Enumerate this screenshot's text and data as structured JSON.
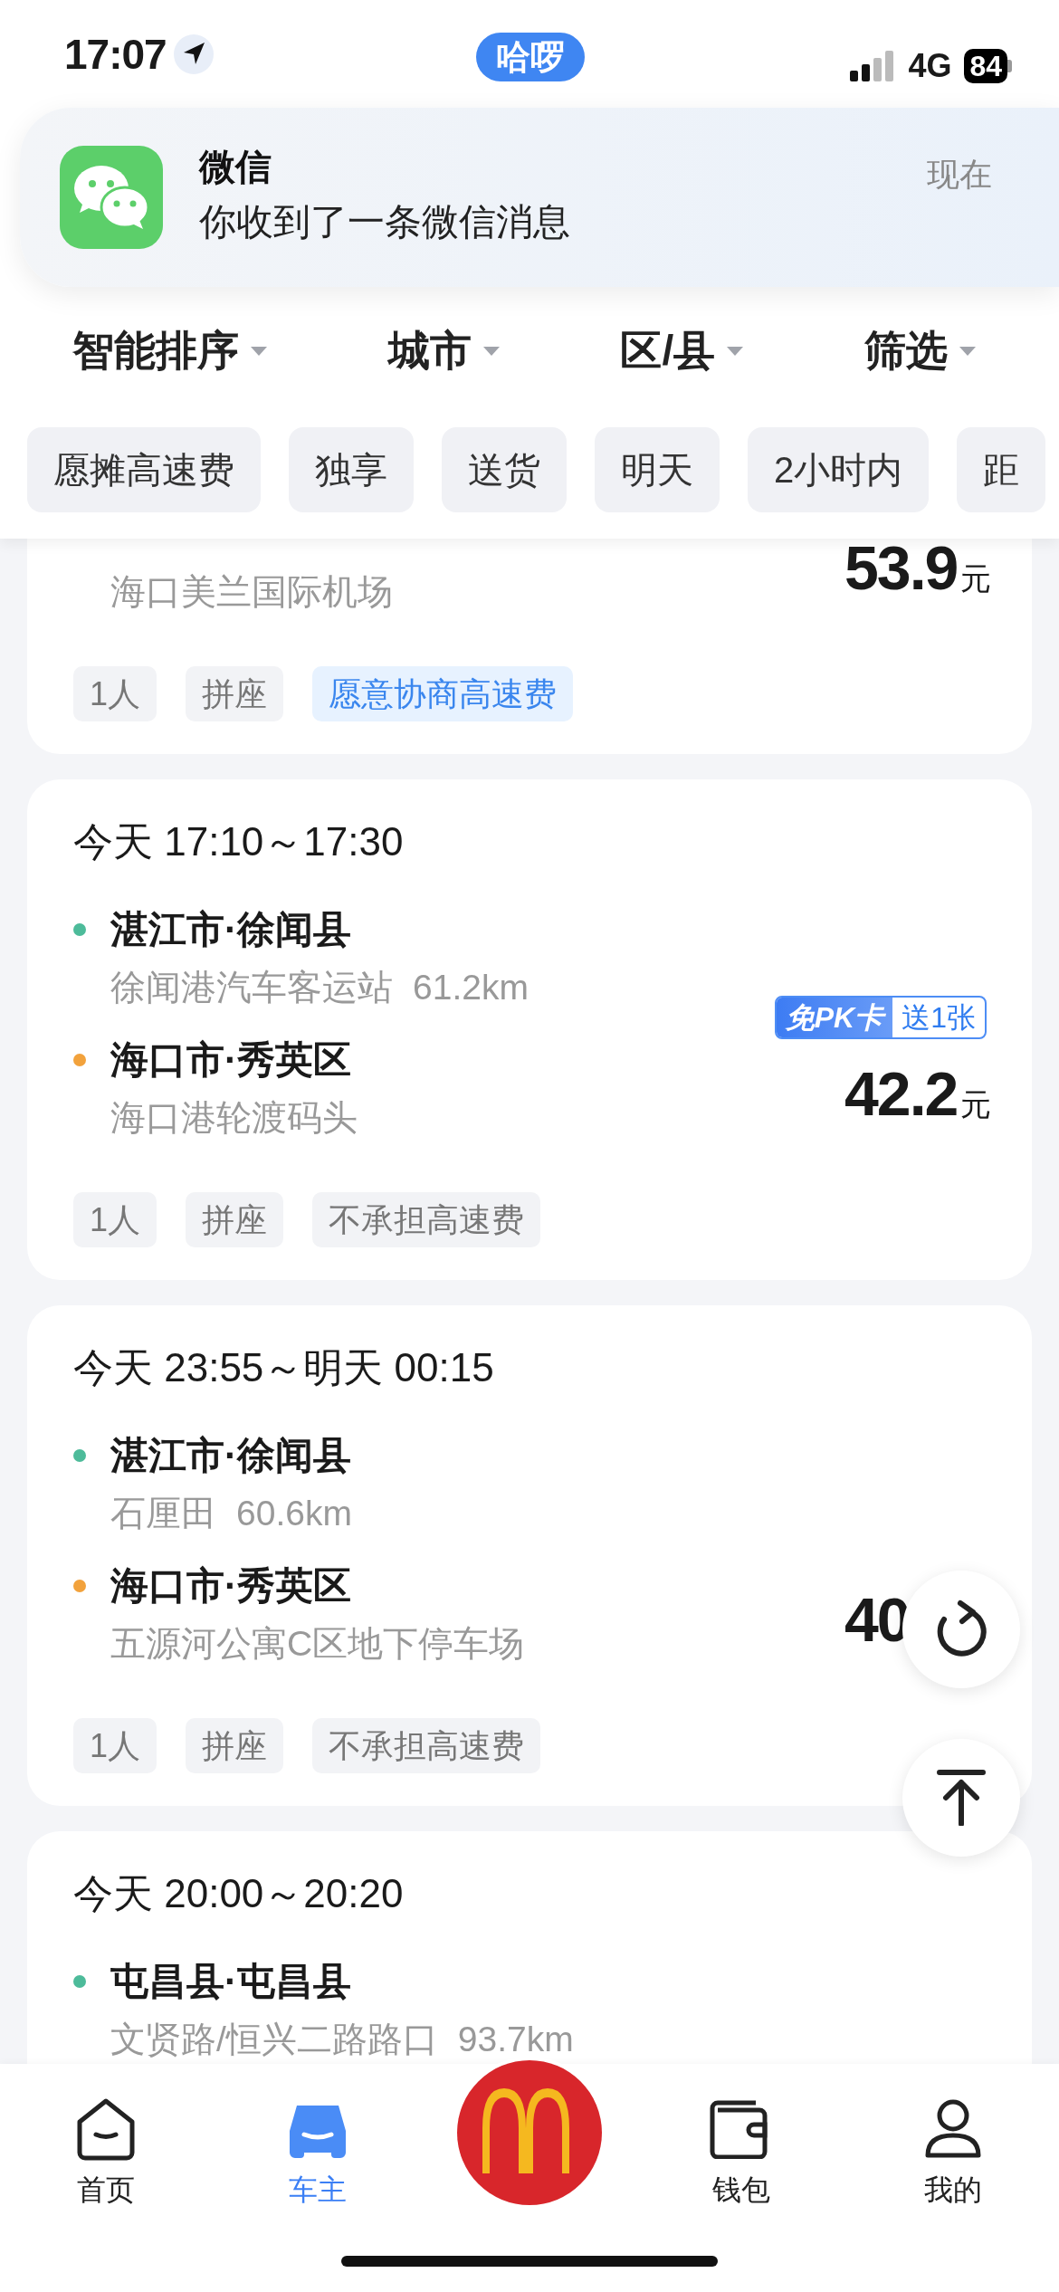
{
  "status_bar": {
    "time": "17:07",
    "app_pill": "哈啰",
    "network": "4G",
    "battery": "84"
  },
  "notification": {
    "app": "微信",
    "message": "你收到了一条微信消息",
    "time": "现在"
  },
  "filters": [
    {
      "label": "智能排序"
    },
    {
      "label": "城市"
    },
    {
      "label": "区/县"
    },
    {
      "label": "筛选"
    }
  ],
  "quick_tags": [
    {
      "label": "愿摊高速费",
      "selected": false
    },
    {
      "label": "独享",
      "selected": false
    },
    {
      "label": "送货",
      "selected": false
    },
    {
      "label": "明天",
      "selected": false
    },
    {
      "label": "2小时内",
      "selected": false
    },
    {
      "label": "距",
      "selected": false
    }
  ],
  "orders": [
    {
      "stops": [
        {
          "detail": "海口美兰国际机场"
        }
      ],
      "price": "53.9",
      "unit": "元",
      "tags": [
        {
          "label": "1人",
          "highlighted": false
        },
        {
          "label": "拼座",
          "highlighted": false
        },
        {
          "label": "愿意协商高速费",
          "highlighted": true
        }
      ]
    },
    {
      "time": "今天 17:10～17:30",
      "stops": [
        {
          "place": "湛江市·徐闻县",
          "detail": "徐闻港汽车客运站",
          "distance": "61.2km",
          "color": "#4dbb9a"
        },
        {
          "place": "海口市·秀英区",
          "detail": "海口港轮渡码头",
          "color": "#f2a23c"
        }
      ],
      "badge": {
        "label": "免PK卡",
        "text": "送1张"
      },
      "price": "42.2",
      "unit": "元",
      "tags": [
        {
          "label": "1人",
          "highlighted": false
        },
        {
          "label": "拼座",
          "highlighted": false
        },
        {
          "label": "不承担高速费",
          "highlighted": false
        }
      ]
    },
    {
      "time": "今天 23:55～明天 00:15",
      "stops": [
        {
          "place": "湛江市·徐闻县",
          "detail": "石厘田",
          "distance": "60.6km",
          "color": "#4dbb9a"
        },
        {
          "place": "海口市·秀英区",
          "detail": "五源河公寓C区地下停车场",
          "color": "#f2a23c"
        }
      ],
      "price": "40",
      "tags": [
        {
          "label": "1人",
          "highlighted": false
        },
        {
          "label": "拼座",
          "highlighted": false
        },
        {
          "label": "不承担高速费",
          "highlighted": false
        }
      ]
    },
    {
      "time": "今天 20:00～20:20",
      "stops": [
        {
          "place": "屯昌县·屯昌县",
          "detail": "文贤路/恒兴二路路口",
          "distance": "93.7km",
          "color": "#4dbb9a"
        }
      ]
    }
  ],
  "tab_bar": [
    {
      "kind": "home",
      "label": "首页",
      "selected": false
    },
    {
      "kind": "car",
      "label": "车主",
      "selected": true
    },
    {
      "kind": "logo"
    },
    {
      "kind": "wallet",
      "label": "钱包",
      "selected": false
    },
    {
      "kind": "person",
      "label": "我的",
      "selected": false
    }
  ]
}
